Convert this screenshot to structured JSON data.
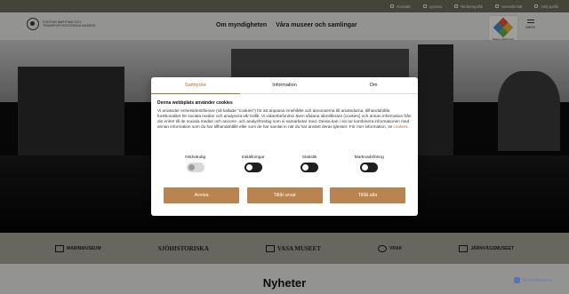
{
  "utility": {
    "items": [
      {
        "label": "Kontakt",
        "icon": "phone-icon"
      },
      {
        "label": "Lyssna",
        "icon": "speaker-icon"
      },
      {
        "label": "Teckenspråk",
        "icon": "sign-language-icon"
      },
      {
        "label": "Svenskt lätt",
        "icon": "easy-read-icon"
      },
      {
        "label": "Välj språk",
        "icon": "globe-icon"
      }
    ]
  },
  "header": {
    "logo_text": "Statens maritima och transporthistoriska museer",
    "nav": [
      "Om myndigheten",
      "Våra museer och samlingar"
    ],
    "badge_text": "Statens maritima och transporthistoriska museer",
    "menu_label": "MENY"
  },
  "dialog": {
    "tabs": [
      "Samtycke",
      "Information",
      "Om"
    ],
    "active_tab": "Samtycke",
    "heading": "Denna webbplats använder cookies",
    "body": "Vi använder enhetsidentifierare (så kallade \"cookies\") för att anpassa innehållet och annonserna till användarna, tillhandahålla funktionalitet för sociala medier och analysera vår trafik. Vi vidarebefordrar även sådana identifierare (cookies) och annan information från din enhet till de sociala medier och annons- och analysföretag som vi samarbetar med. Dessa kan i sin tur kombinera informationen med annan information som du har tillhandahållit eller som de har samlat in när du har använt deras tjänster. För mer information, se",
    "link_text": "cookies",
    "toggles": [
      {
        "label": "Nödvändig",
        "on": true,
        "disabled": true
      },
      {
        "label": "Inställningar",
        "on": false,
        "disabled": false
      },
      {
        "label": "Statistik",
        "on": false,
        "disabled": false
      },
      {
        "label": "Marknadsföring",
        "on": false,
        "disabled": false
      }
    ],
    "buttons": {
      "deny": "Avvisa",
      "selection": "Tillåt urval",
      "allow_all": "Tillåt alla"
    },
    "accent": "#b9844f"
  },
  "partners": [
    {
      "label": "MARINMUSEUM"
    },
    {
      "label": "SJÖHISTORISKA"
    },
    {
      "label": "VASA MUSEET"
    },
    {
      "label": "VRAK"
    },
    {
      "label": "JÄRNVÄGSMUSEET"
    }
  ],
  "news": {
    "title": "Nyheter"
  },
  "watermark": {
    "text": "ScanMetasea"
  }
}
